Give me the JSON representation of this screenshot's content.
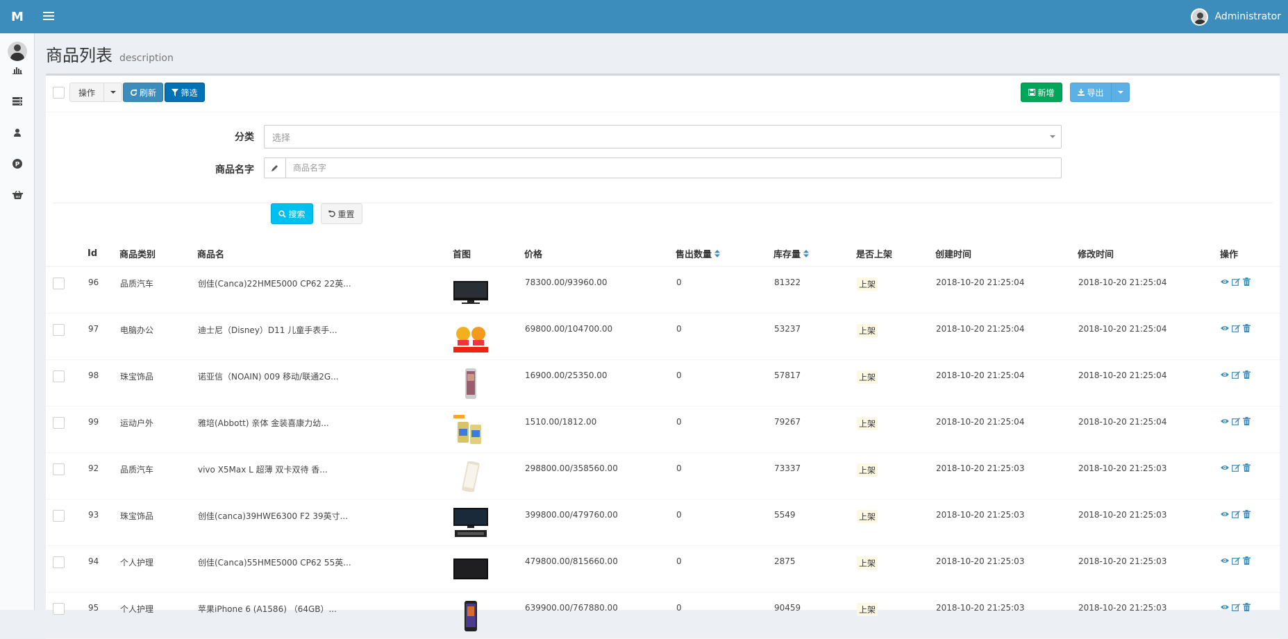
{
  "header": {
    "logo": "M",
    "user_name": "Administrator"
  },
  "sidebar": {
    "items": [
      {
        "icon": "bar-chart-icon"
      },
      {
        "icon": "server-icon"
      },
      {
        "icon": "user-icon"
      },
      {
        "icon": "parking-icon"
      },
      {
        "icon": "basket-icon"
      }
    ]
  },
  "page": {
    "title": "商品列表",
    "description": "description"
  },
  "toolbar": {
    "action_label": "操作",
    "refresh_label": "刷新",
    "filter_label": "筛选",
    "new_label": "新增",
    "export_label": "导出"
  },
  "filter": {
    "category_label": "分类",
    "category_placeholder": "选择",
    "name_label": "商品名字",
    "name_placeholder": "商品名字",
    "search_label": "搜索",
    "reset_label": "重置"
  },
  "table": {
    "columns": [
      "Id",
      "商品类别",
      "商品名",
      "首图",
      "价格",
      "售出数量",
      "库存量",
      "是否上架",
      "创建时间",
      "修改时间",
      "操作"
    ],
    "rows": [
      {
        "id": "96",
        "category": "品质汽车",
        "name": "创佳(Canca)22HME5000 CP62 22英...",
        "price": "78300.00/93960.00",
        "sold": "0",
        "stock": "81322",
        "status": "上架",
        "created": "2018-10-20 21:25:04",
        "modified": "2018-10-20 21:25:04"
      },
      {
        "id": "97",
        "category": "电脑办公",
        "name": "迪士尼（Disney）D11 儿童手表手...",
        "price": "69800.00/104700.00",
        "sold": "0",
        "stock": "53237",
        "status": "上架",
        "created": "2018-10-20 21:25:04",
        "modified": "2018-10-20 21:25:04"
      },
      {
        "id": "98",
        "category": "珠宝饰品",
        "name": "诺亚信（NOAIN) 009 移动/联通2G...",
        "price": "16900.00/25350.00",
        "sold": "0",
        "stock": "57817",
        "status": "上架",
        "created": "2018-10-20 21:25:04",
        "modified": "2018-10-20 21:25:04"
      },
      {
        "id": "99",
        "category": "运动户外",
        "name": "雅培(Abbott) 亲体 金装喜康力幼...",
        "price": "1510.00/1812.00",
        "sold": "0",
        "stock": "79267",
        "status": "上架",
        "created": "2018-10-20 21:25:04",
        "modified": "2018-10-20 21:25:04"
      },
      {
        "id": "92",
        "category": "品质汽车",
        "name": "vivo X5Max L 超薄 双卡双待 香...",
        "price": "298800.00/358560.00",
        "sold": "0",
        "stock": "73337",
        "status": "上架",
        "created": "2018-10-20 21:25:03",
        "modified": "2018-10-20 21:25:03"
      },
      {
        "id": "93",
        "category": "珠宝饰品",
        "name": "创佳(canca)39HWE6300 F2 39英寸...",
        "price": "399800.00/479760.00",
        "sold": "0",
        "stock": "5549",
        "status": "上架",
        "created": "2018-10-20 21:25:03",
        "modified": "2018-10-20 21:25:03"
      },
      {
        "id": "94",
        "category": "个人护理",
        "name": "创佳(Canca)55HME5000 CP62 55英...",
        "price": "479800.00/815660.00",
        "sold": "0",
        "stock": "2875",
        "status": "上架",
        "created": "2018-10-20 21:25:03",
        "modified": "2018-10-20 21:25:03"
      },
      {
        "id": "95",
        "category": "个人护理",
        "name": "苹果iPhone 6 (A1586) （64GB）...",
        "price": "639900.00/767880.00",
        "sold": "0",
        "stock": "90459",
        "status": "上架",
        "created": "2018-10-20 21:25:03",
        "modified": "2018-10-20 21:25:03"
      }
    ]
  },
  "colors": {
    "header": "#3c8dbc",
    "link": "#3c8dbc",
    "success": "#00a65a",
    "search": "#00c0ef"
  }
}
